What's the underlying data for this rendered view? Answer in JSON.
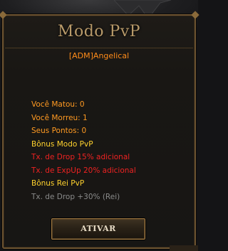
{
  "window": {
    "title": "Modo PvP",
    "player_name": "[ADM]Angelical"
  },
  "stats": {
    "kills": "Você Matou: 0",
    "deaths": "Você Morreu: 1",
    "points": "Seus Pontos: 0"
  },
  "bonus": {
    "mode_header": "Bônus Modo PvP",
    "drop_bonus": "Tx. de Drop 15% adicional",
    "exp_bonus": "Tx. de ExpUp 20% adicional",
    "king_header": "Bônus Rei PvP",
    "king_drop_bonus": "Tx. de Drop +30% (Rei)"
  },
  "actions": {
    "activate_label": "ATIVAR"
  },
  "colors": {
    "orange": "#ff9a22",
    "yellow": "#ffd22e",
    "red": "#ee2222",
    "gray": "#8a8a8a",
    "gold_border": "#6b5230"
  }
}
